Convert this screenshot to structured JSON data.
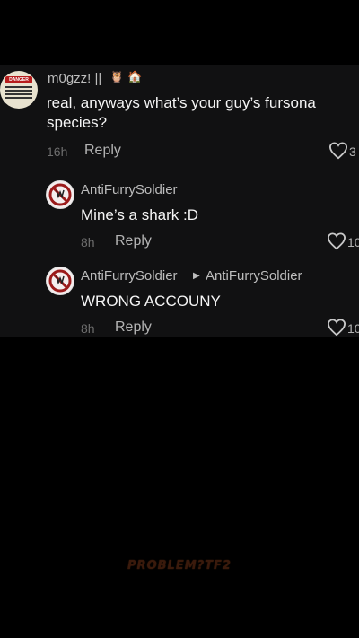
{
  "comments": [
    {
      "username": "m0gzz! ||",
      "emojis": [
        "🦉",
        "🏠"
      ],
      "text": "real, anyways what’s your guy’s fursona species?",
      "time": "16h",
      "reply_label": "Reply",
      "likes": "3",
      "avatar_badge": "DANGER"
    },
    {
      "username": "AntiFurrySoldier",
      "text": "Mine’s a shark :D",
      "time": "8h",
      "reply_label": "Reply",
      "likes": "10"
    },
    {
      "username": "AntiFurrySoldier",
      "reply_to": "AntiFurrySoldier",
      "text": "WRONG ACCOUNY",
      "time": "8h",
      "reply_label": "Reply",
      "likes": "10"
    }
  ],
  "watermark": "PROBLEM?TF2"
}
